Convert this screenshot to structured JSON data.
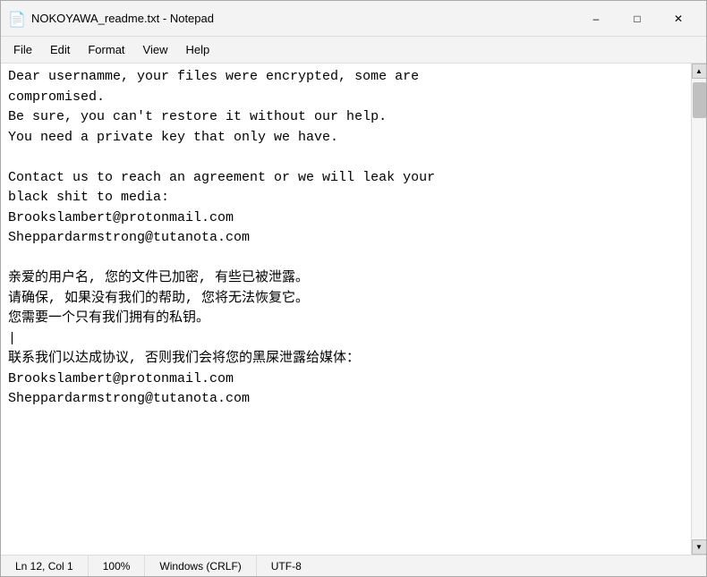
{
  "window": {
    "title": "NOKOYAWA_readme.txt - Notepad",
    "icon": "📄"
  },
  "titlebar": {
    "minimize_label": "–",
    "maximize_label": "□",
    "close_label": "✕"
  },
  "menubar": {
    "items": [
      "File",
      "Edit",
      "Format",
      "View",
      "Help"
    ]
  },
  "content": {
    "text": "Dear usernamme, your files were encrypted, some are\ncompromised.\nBe sure, you can't restore it without our help.\nYou need a private key that only we have.\n\nContact us to reach an agreement or we will leak your\nblack shit to media:\nBrookslambert@protonmail.com\nSheppardarmstrong@tutanota.com\n\n亲爱的用户名, 您的文件已加密, 有些已被泄露。\n请确保, 如果没有我们的帮助, 您将无法恢复它。\n您需要一个只有我们拥有的私钥。\n|\n联系我们以达成协议, 否则我们会将您的黑屎泄露给媒体：\nBrookslambert@protonmail.com\nSheppardarmstrong@tutanota.com"
  },
  "statusbar": {
    "position": "Ln 12, Col 1",
    "zoom": "100%",
    "line_ending": "Windows (CRLF)",
    "encoding": "UTF-8"
  }
}
